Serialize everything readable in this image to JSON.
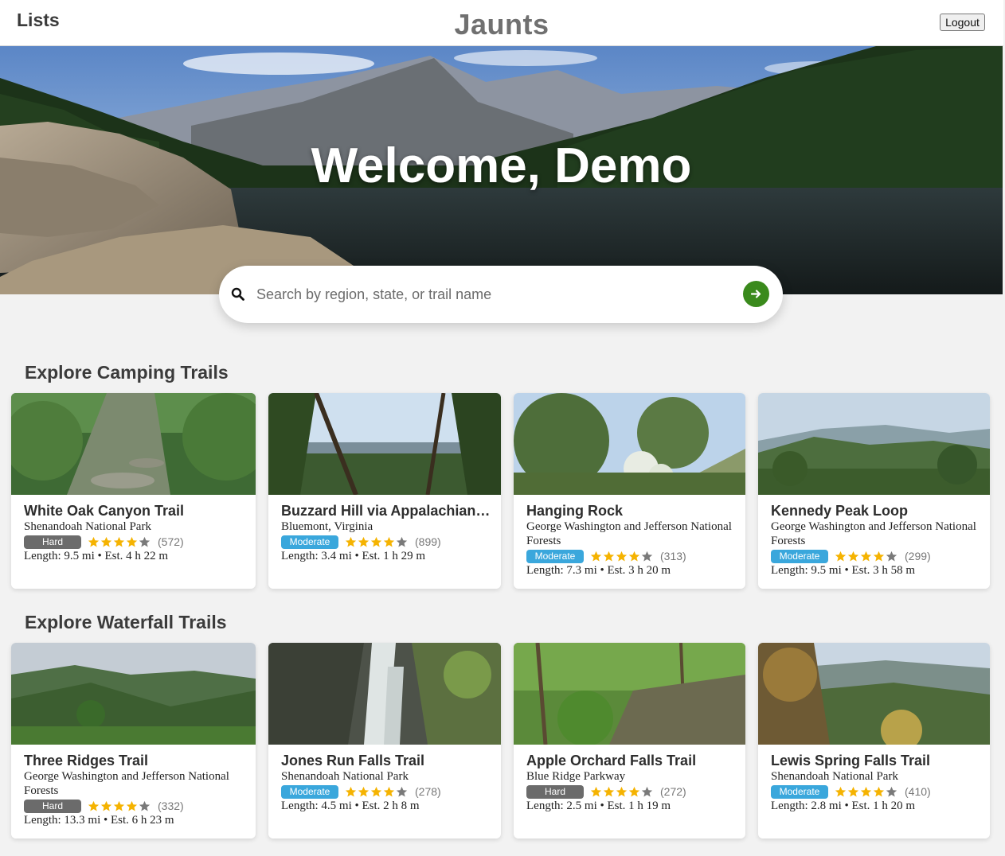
{
  "header": {
    "lists_label": "Lists",
    "brand": "Jaunts",
    "logout_label": "Logout"
  },
  "hero": {
    "title": "Welcome, Demo"
  },
  "search": {
    "placeholder": "Search by region, state, or trail name"
  },
  "colors": {
    "accent_green": "#3a8a1c",
    "badge_hard": "#6b6b6b",
    "badge_moderate": "#3aa7dc",
    "star": "#f5b301"
  },
  "sections": [
    {
      "title": "Explore Camping Trails",
      "cards": [
        {
          "name": "White Oak Canyon Trail",
          "location": "Shenandoah National Park",
          "difficulty": "Hard",
          "rating": 4,
          "reviews": "(572)",
          "length": "Length: 9.5 mi • Est. 4 h 22 m"
        },
        {
          "name": "Buzzard Hill via Appalachian Trail",
          "location": "Bluemont, Virginia",
          "difficulty": "Moderate",
          "rating": 4,
          "reviews": "(899)",
          "length": "Length: 3.4 mi • Est. 1 h 29 m"
        },
        {
          "name": "Hanging Rock",
          "location": "George Washington and Jefferson National Forests",
          "difficulty": "Moderate",
          "rating": 4,
          "reviews": "(313)",
          "length": "Length: 7.3 mi • Est. 3 h 20 m"
        },
        {
          "name": "Kennedy Peak Loop",
          "location": "George Washington and Jefferson National Forests",
          "difficulty": "Moderate",
          "rating": 4,
          "reviews": "(299)",
          "length": "Length: 9.5 mi • Est. 3 h 58 m"
        }
      ]
    },
    {
      "title": "Explore Waterfall Trails",
      "cards": [
        {
          "name": "Three Ridges Trail",
          "location": "George Washington and Jefferson National Forests",
          "difficulty": "Hard",
          "rating": 4,
          "reviews": "(332)",
          "length": "Length: 13.3 mi • Est. 6 h 23 m"
        },
        {
          "name": "Jones Run Falls Trail",
          "location": "Shenandoah National Park",
          "difficulty": "Moderate",
          "rating": 4,
          "reviews": "(278)",
          "length": "Length: 4.5 mi • Est. 2 h 8 m"
        },
        {
          "name": "Apple Orchard Falls Trail",
          "location": "Blue Ridge Parkway",
          "difficulty": "Hard",
          "rating": 4,
          "reviews": "(272)",
          "length": "Length: 2.5 mi • Est. 1 h 19 m"
        },
        {
          "name": "Lewis Spring Falls Trail",
          "location": "Shenandoah National Park",
          "difficulty": "Moderate",
          "rating": 4,
          "reviews": "(410)",
          "length": "Length: 2.8 mi • Est. 1 h 20 m"
        }
      ]
    }
  ]
}
